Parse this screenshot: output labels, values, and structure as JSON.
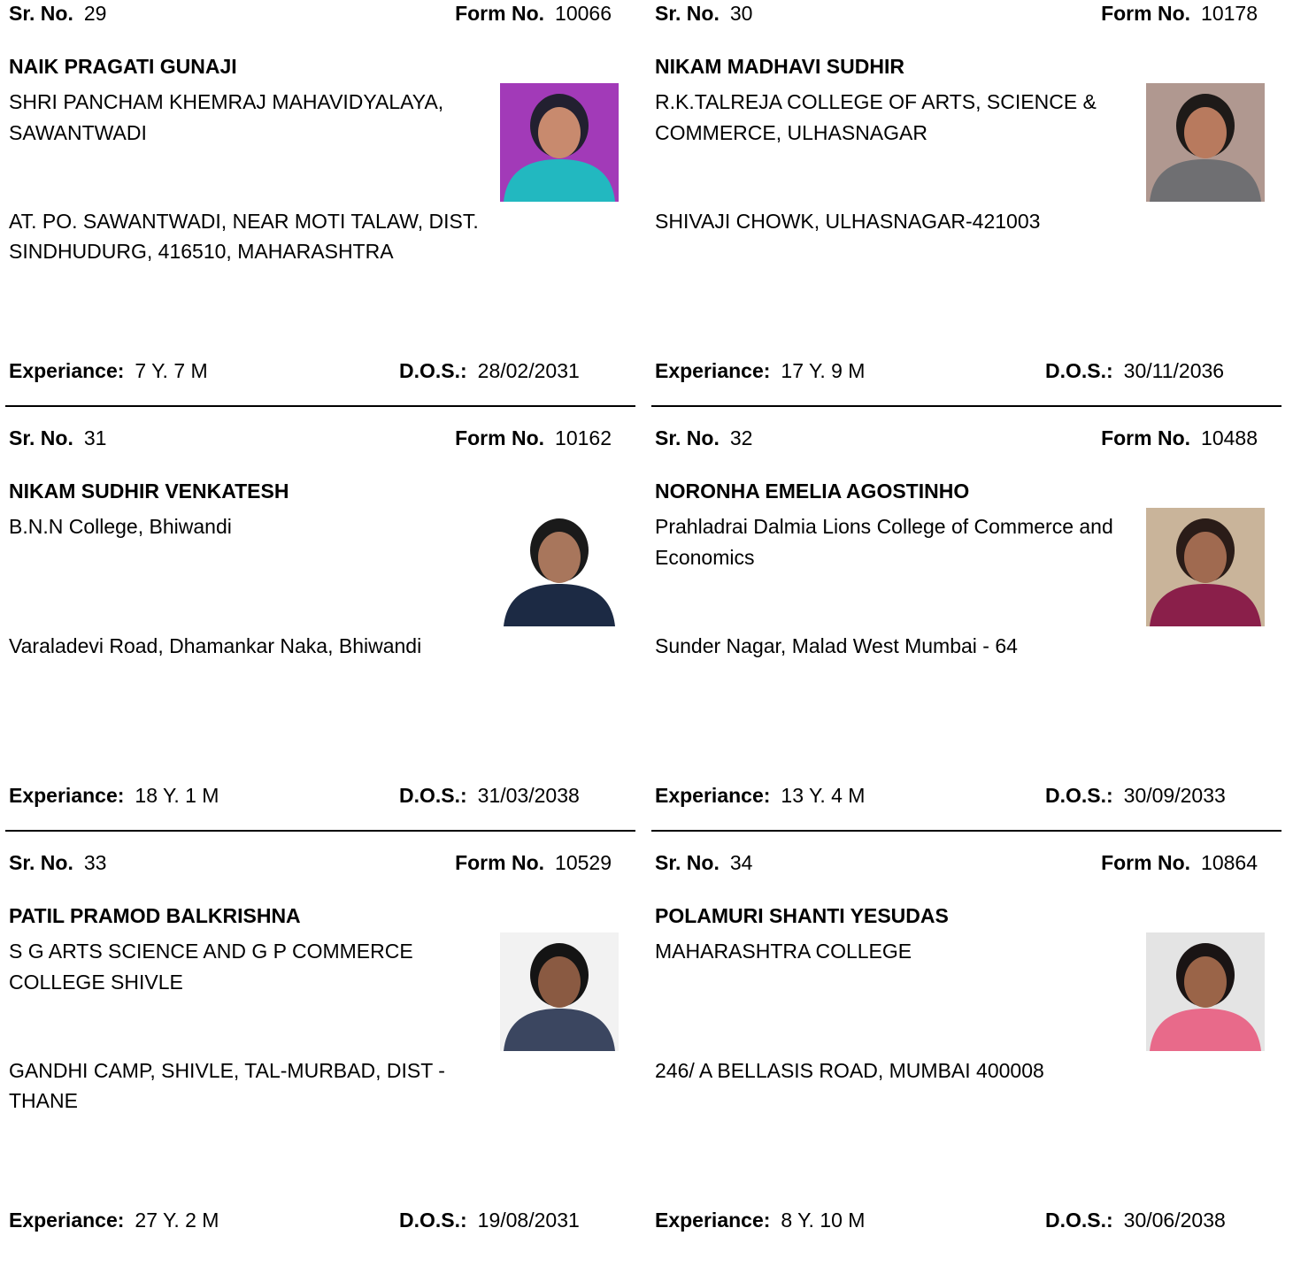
{
  "labels": {
    "sr_no": "Sr. No.",
    "form_no": "Form No.",
    "experience": "Experiance:",
    "dos": "D.O.S.:"
  },
  "entries": [
    {
      "sr_no": "29",
      "form_no": "10066",
      "name": "NAIK PRAGATI GUNAJI",
      "college": "SHRI PANCHAM KHEMRAJ MAHAVIDYALAYA, SAWANTWADI",
      "address": "AT. PO. SAWANTWADI, NEAR MOTI TALAW, DIST. SINDHUDURG, 416510, MAHARASHTRA",
      "experience": "7 Y. 7 M",
      "dos": "28/02/2031",
      "photo": {
        "bg": "#a23ab8",
        "skin": "#c88a6e",
        "hair": "#222030",
        "cloth": "#22b8c0"
      }
    },
    {
      "sr_no": "30",
      "form_no": "10178",
      "name": "NIKAM MADHAVI SUDHIR",
      "college": "R.K.TALREJA COLLEGE OF ARTS, SCIENCE & COMMERCE, ULHASNAGAR",
      "address": "SHIVAJI CHOWK, ULHASNAGAR-421003",
      "experience": "17 Y. 9 M",
      "dos": "30/11/2036",
      "photo": {
        "bg": "#b09890",
        "skin": "#b87a5e",
        "hair": "#1e1a18",
        "cloth": "#6f6f72"
      }
    },
    {
      "sr_no": "31",
      "form_no": "10162",
      "name": "NIKAM SUDHIR VENKATESH",
      "college": "B.N.N  College, Bhiwandi",
      "address": "Varaladevi Road, Dhamankar Naka, Bhiwandi",
      "experience": "18 Y. 1 M",
      "dos": "31/03/2038",
      "photo": {
        "bg": "#ffffff",
        "skin": "#a8765c",
        "hair": "#1a1a1a",
        "cloth": "#1c2a44"
      }
    },
    {
      "sr_no": "32",
      "form_no": "10488",
      "name": "NORONHA EMELIA AGOSTINHO",
      "college": "Prahladrai Dalmia Lions College of Commerce and Economics",
      "address": "Sunder Nagar, Malad West Mumbai - 64",
      "experience": "13 Y. 4 M",
      "dos": "30/09/2033",
      "photo": {
        "bg": "#c9b49a",
        "skin": "#a06a50",
        "hair": "#2a1c18",
        "cloth": "#8a1f4a"
      }
    },
    {
      "sr_no": "33",
      "form_no": "10529",
      "name": "PATIL PRAMOD BALKRISHNA",
      "college": "S G ARTS SCIENCE AND G P COMMERCE COLLEGE SHIVLE",
      "address": "GANDHI CAMP, SHIVLE, TAL-MURBAD, DIST -THANE",
      "experience": "27 Y. 2 M",
      "dos": "19/08/2031",
      "photo": {
        "bg": "#f2f2f2",
        "skin": "#8a5a42",
        "hair": "#141414",
        "cloth": "#3b4660"
      }
    },
    {
      "sr_no": "34",
      "form_no": "10864",
      "name": "POLAMURI SHANTI YESUDAS",
      "college": "MAHARASHTRA COLLEGE",
      "address": "246/ A BELLASIS ROAD, MUMBAI 400008",
      "experience": "8 Y. 10 M",
      "dos": "30/06/2038",
      "photo": {
        "bg": "#e4e4e4",
        "skin": "#9a6448",
        "hair": "#1a1414",
        "cloth": "#e86a8a"
      }
    }
  ]
}
